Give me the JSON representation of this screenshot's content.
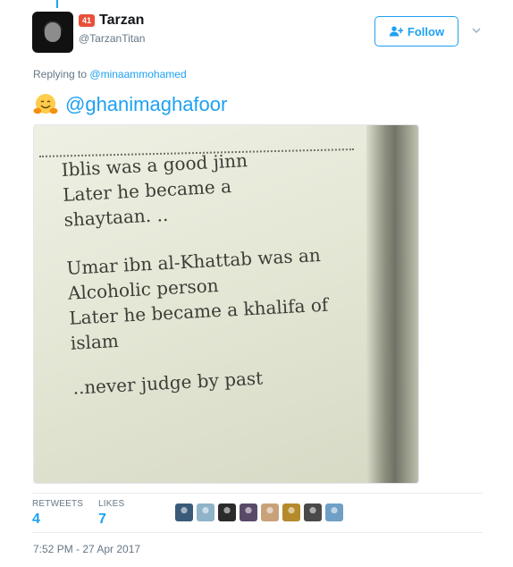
{
  "author": {
    "badge_count": "41",
    "display_name": "Tarzan",
    "handle": "@TarzanTitan"
  },
  "follow_button": {
    "label": "Follow"
  },
  "reply": {
    "prefix": "Replying to",
    "to_handle": "@minaammohamed"
  },
  "tweet": {
    "emoji": "hugging-face-emoji",
    "mention": "@ghanimaghafoor"
  },
  "image_text": {
    "lines_1": [
      "Iblis was a good jinn",
      "Later he became a",
      "shaytaan. .."
    ],
    "lines_2": [
      "Umar ibn al-Khattab was an",
      "Alcoholic person",
      "Later he became a khalifa of",
      "islam"
    ],
    "lines_3": [
      "..never judge by past"
    ]
  },
  "stats": {
    "retweets_label": "RETWEETS",
    "retweets_count": "4",
    "likes_label": "LIKES",
    "likes_count": "7"
  },
  "likers": [
    {
      "name": "liker-avatar-1",
      "color": "#3a5a7a"
    },
    {
      "name": "liker-avatar-2",
      "color": "#8fb3c9"
    },
    {
      "name": "liker-avatar-3",
      "color": "#2b2b2b"
    },
    {
      "name": "liker-avatar-4",
      "color": "#5a4a6a"
    },
    {
      "name": "liker-avatar-5",
      "color": "#c9a27a"
    },
    {
      "name": "liker-avatar-6",
      "color": "#b58a2a"
    },
    {
      "name": "liker-avatar-7",
      "color": "#4a4a4a"
    },
    {
      "name": "liker-avatar-8",
      "color": "#6f9fc4"
    }
  ],
  "timestamp": "7:52 PM - 27 Apr 2017",
  "colors": {
    "accent": "#1da1f2",
    "muted": "#657786",
    "badge": "#e8503a"
  }
}
